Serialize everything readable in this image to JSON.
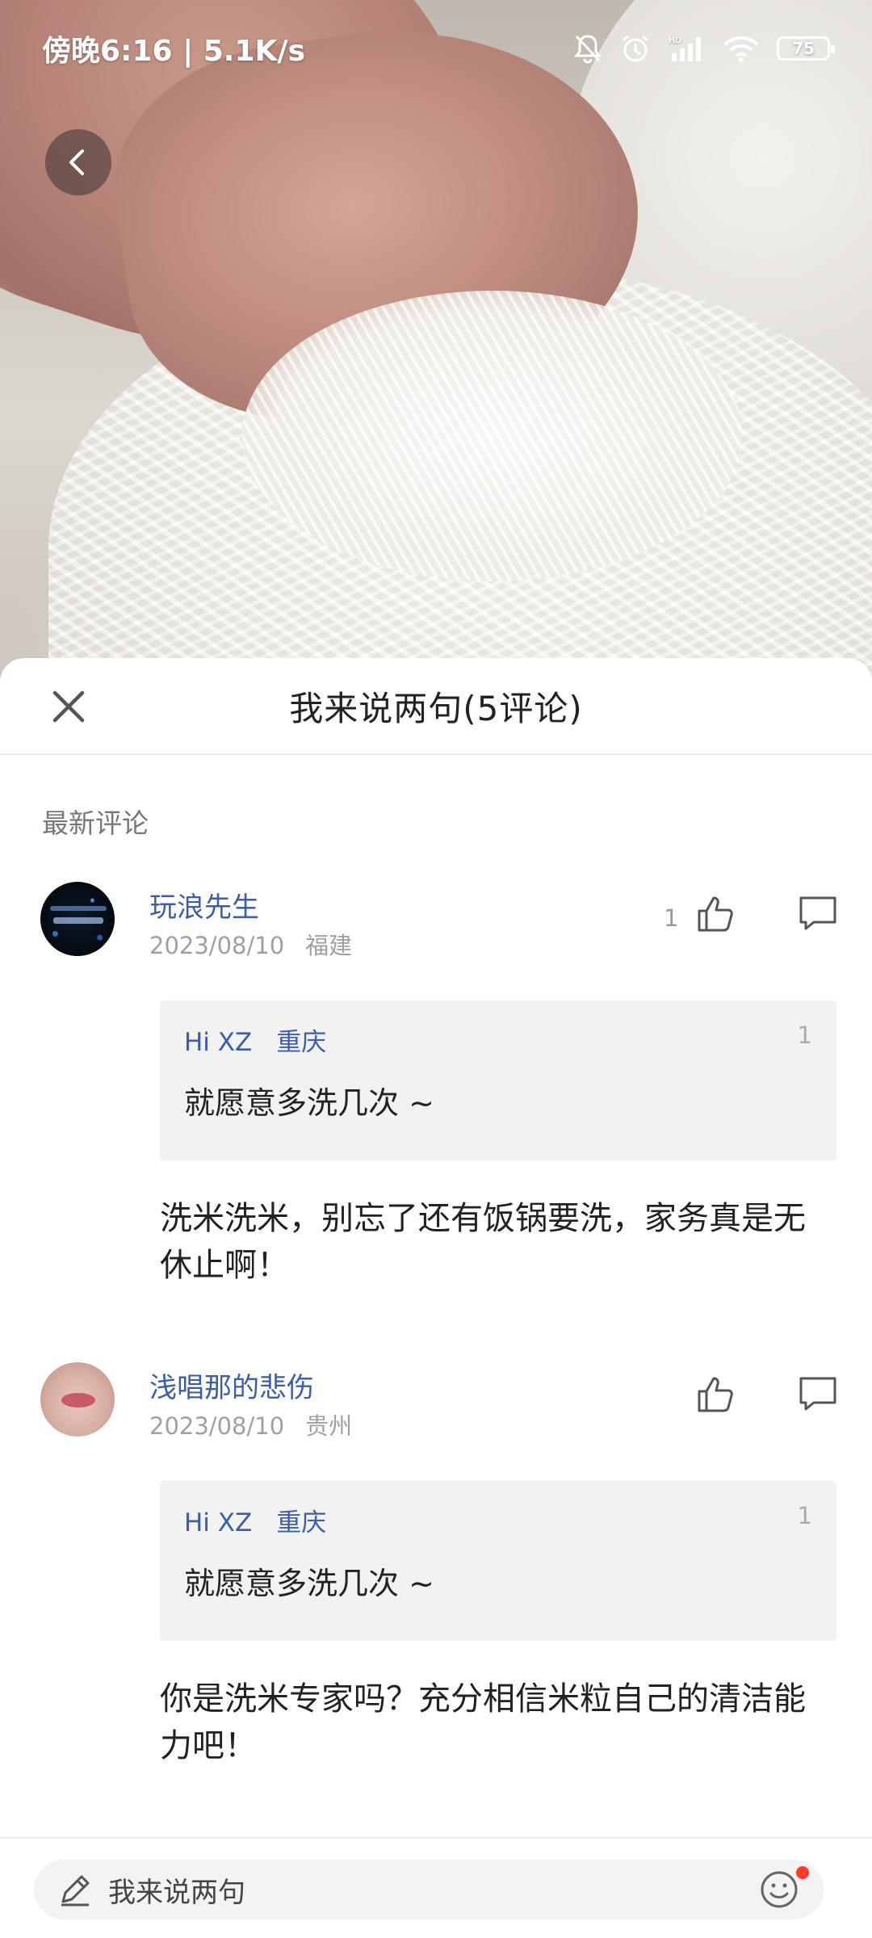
{
  "status_bar": {
    "time": "傍晚6:16 | 5.1K/s",
    "battery": "75"
  },
  "sheet": {
    "title": "我来说两句(5评论)",
    "section_label": "最新评论"
  },
  "comments": [
    {
      "user": "玩浪先生",
      "date": "2023/08/10",
      "location": "福建",
      "likes": "1",
      "quote": {
        "user": "Hi XZ",
        "location": "重庆",
        "num": "1",
        "text": "就愿意多洗几次 ~"
      },
      "text": "洗米洗米，别忘了还有饭锅要洗，家务真是无休止啊！"
    },
    {
      "user": "浅唱那的悲伤",
      "date": "2023/08/10",
      "location": "贵州",
      "likes": "",
      "quote": {
        "user": "Hi XZ",
        "location": "重庆",
        "num": "1",
        "text": "就愿意多洗几次 ~"
      },
      "text": "你是洗米专家吗？充分相信米粒自己的清洁能力吧！"
    }
  ],
  "input": {
    "placeholder": "我来说两句"
  },
  "colors": {
    "username": "#3c5ea5",
    "meta": "#a0a0a0",
    "quote_bg": "#f2f2f2",
    "notification_dot": "#ff3b2f"
  },
  "icons": [
    "back-icon",
    "mute-icon",
    "alarm-icon",
    "signal-icon",
    "wifi-icon",
    "battery-icon",
    "close-icon",
    "thumbs-up-icon",
    "comment-bubble-icon",
    "pencil-icon",
    "emoji-icon"
  ]
}
